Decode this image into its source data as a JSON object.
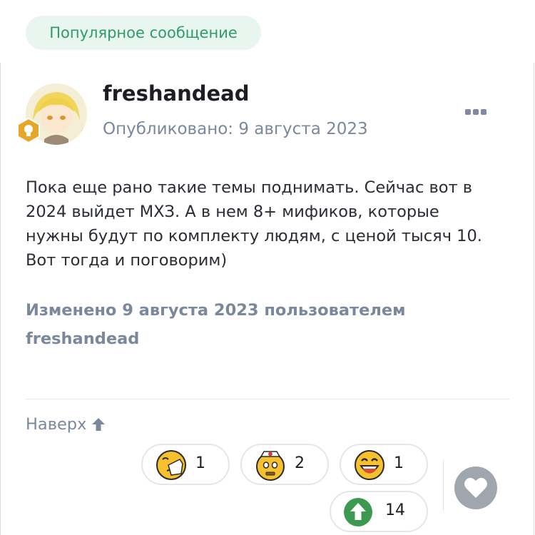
{
  "badge": {
    "label": "Популярное сообщение"
  },
  "post": {
    "author": "freshandead",
    "published": "Опубликовано: 9 августа 2023",
    "body_lines": [
      "Пока еще рано такие темы поднимать. Сейчас вот в",
      "2024 выйдет МХЗ. А в нем 8+ мификов, которые",
      "нужны будут по комплекту людям, с ценой тысяч 10.",
      "Вот тогда и поговорим)"
    ],
    "edited_line1": "Изменено 9 августа 2023 пользователем",
    "edited_line2": "freshandead"
  },
  "footer": {
    "back_to_top": "Наверх"
  },
  "reactions": [
    {
      "icon": "facepalm-emoji-icon",
      "count": "1"
    },
    {
      "icon": "nurse-emoji-icon",
      "count": "2"
    },
    {
      "icon": "grinning-emoji-icon",
      "count": "1"
    },
    {
      "icon": "upvote-icon",
      "count": "14"
    }
  ],
  "colors": {
    "accent_green": "#2e9c6a",
    "muted": "#7b889c"
  }
}
